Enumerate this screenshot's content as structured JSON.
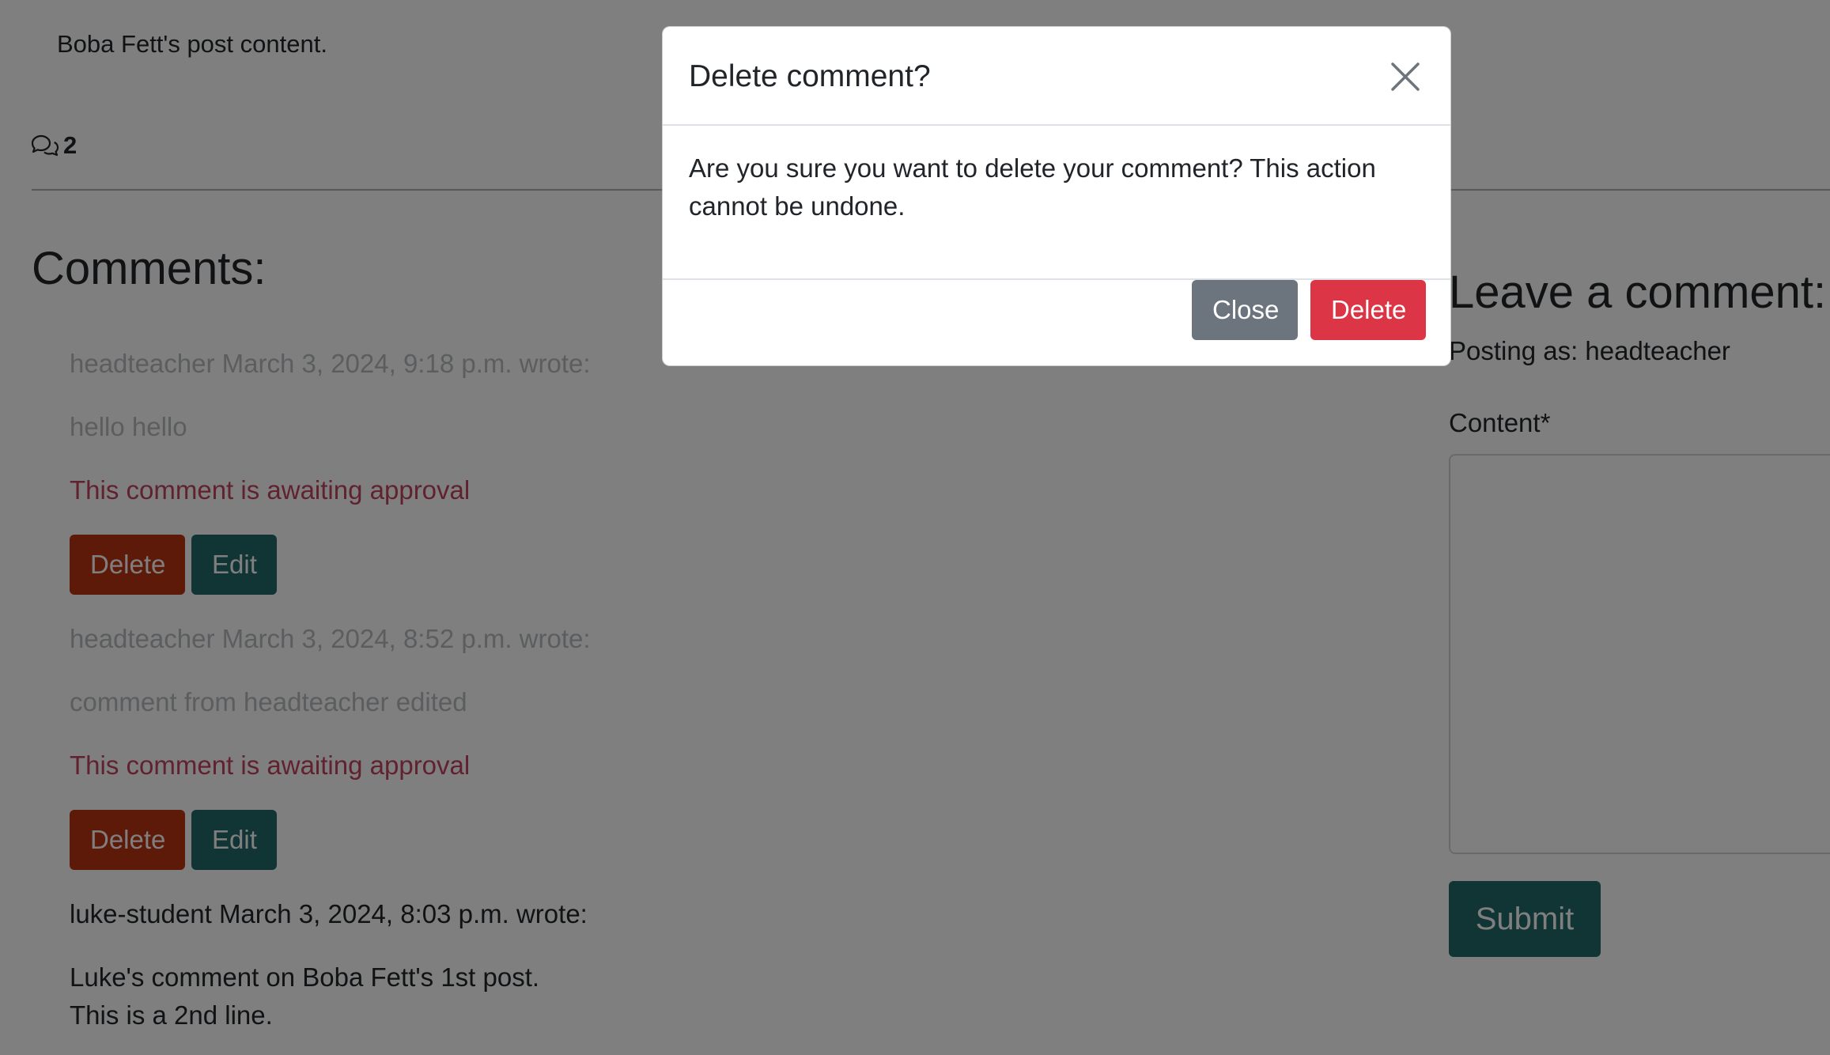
{
  "post": {
    "content": "Boba Fett's post content.",
    "comment_count": "2"
  },
  "comments_section": {
    "heading": "Comments:",
    "comments": [
      {
        "meta": "headteacher March 3, 2024, 9:18 p.m. wrote:",
        "body": "hello hello",
        "status": "This comment is awaiting approval",
        "delete_label": "Delete",
        "edit_label": "Edit"
      },
      {
        "meta": "headteacher March 3, 2024, 8:52 p.m. wrote:",
        "body": "comment from headteacher edited",
        "status": "This comment is awaiting approval",
        "delete_label": "Delete",
        "edit_label": "Edit"
      },
      {
        "meta": "luke-student March 3, 2024, 8:03 p.m. wrote:",
        "body_lines": [
          "Luke's comment on Boba Fett's 1st post.",
          "This is a 2nd line."
        ]
      }
    ]
  },
  "comment_form": {
    "heading": "Leave a comment:",
    "posting_as": "Posting as: headteacher",
    "content_label": "Content*",
    "content_value": "",
    "submit_label": "Submit"
  },
  "modal": {
    "title": "Delete comment?",
    "body": "Are you sure you want to delete your comment? This action cannot be undone.",
    "close_label": "Close",
    "delete_label": "Delete"
  },
  "colors": {
    "danger_dark": "#bd3513",
    "teal": "#236a6a",
    "secondary": "#6c757d",
    "danger": "#dc3545",
    "pending_text": "#c2445f"
  },
  "icons": {
    "comment_count": "chat-bubbles-icon",
    "modal_close": "close-icon"
  }
}
